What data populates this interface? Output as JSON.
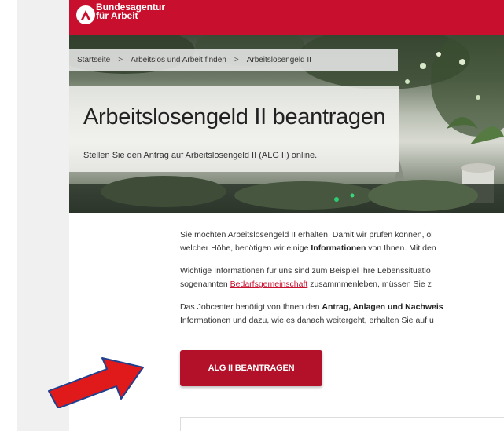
{
  "header": {
    "logo_line1": "Bundesagentur",
    "logo_line2": "für Arbeit",
    "brand_color": "#c8102e"
  },
  "breadcrumb": {
    "items": [
      "Startseite",
      "Arbeitslos und Arbeit finden",
      "Arbeitslosengeld II"
    ],
    "separator": ">"
  },
  "hero": {
    "title": "Arbeitslosengeld II beantragen",
    "subtitle": "Stellen Sie den Antrag auf Arbeitslosengeld II (ALG II) online."
  },
  "content": {
    "p1_line1": "Sie möchten Arbeitslosengeld II erhalten. Damit wir prüfen können, ol",
    "p1_line2_a": "welcher Höhe, benötigen wir einige ",
    "p1_line2_b": "Informationen",
    "p1_line2_c": " von Ihnen. Mit den",
    "p2_line1": "Wichtige Informationen für uns sind zum Beispiel Ihre Lebenssituatio",
    "p2_line2_a": "sogenannten ",
    "p2_line2_link": "Bedarfsgemeinschaft",
    "p2_line2_c": " zusammmenleben, müssen Sie z",
    "p3_line1_a": "Das Jobcenter benötigt von Ihnen den ",
    "p3_line1_b": "Antrag, Anlagen und Nachweis",
    "p3_line2": "Informationen und dazu, wie es danach weitergeht, erhalten Sie auf u"
  },
  "cta": {
    "label": "ALG II BEANTRAGEN",
    "color": "#b3102a"
  },
  "annotation": {
    "arrow_color": "#e0191b"
  }
}
